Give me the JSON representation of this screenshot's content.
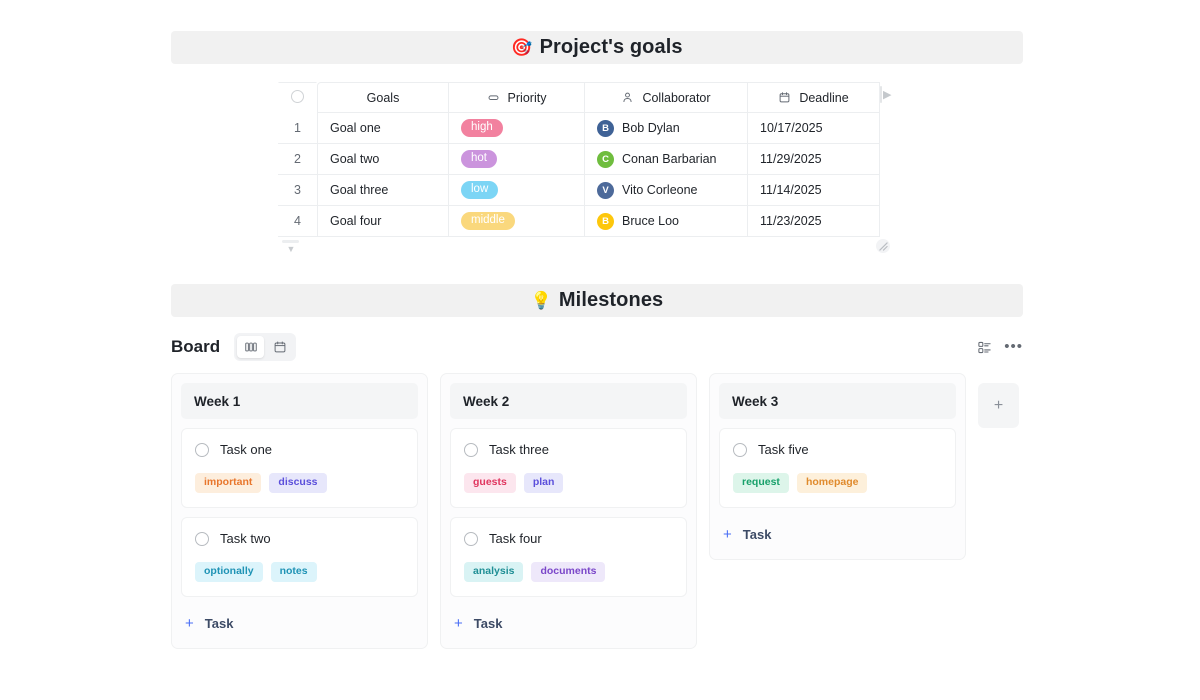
{
  "sections": {
    "goals_banner": {
      "emoji": "🎯",
      "title": "Project's goals",
      "icon": "target-icon"
    },
    "milestones_banner": {
      "emoji": "💡",
      "title": "Milestones",
      "icon": "lightbulb-icon"
    }
  },
  "goals_table": {
    "columns": [
      {
        "label": "Goals",
        "icon": null
      },
      {
        "label": "Priority",
        "icon": "capsule-icon"
      },
      {
        "label": "Collaborator",
        "icon": "person-icon"
      },
      {
        "label": "Deadline",
        "icon": "calendar-icon"
      }
    ],
    "rows": [
      {
        "index": "1",
        "goal": "Goal one",
        "priority": "high",
        "priority_color": "#f2819f",
        "collaborator": "Bob Dylan",
        "initial": "B",
        "avatar_color": "#3f6296",
        "deadline": "10/17/2025"
      },
      {
        "index": "2",
        "goal": "Goal two",
        "priority": "hot",
        "priority_color": "#cb94dd",
        "collaborator": "Conan Barbarian",
        "initial": "C",
        "avatar_color": "#6fbd3e",
        "deadline": "11/29/2025"
      },
      {
        "index": "3",
        "goal": "Goal three",
        "priority": "low",
        "priority_color": "#7cd5f5",
        "collaborator": "Vito Corleone",
        "initial": "V",
        "avatar_color": "#4d6a9a",
        "deadline": "11/14/2025"
      },
      {
        "index": "4",
        "goal": "Goal four",
        "priority": "middle",
        "priority_color": "#fad87d",
        "collaborator": "Bruce Loo",
        "initial": "B",
        "avatar_color": "#fdc70c",
        "deadline": "11/23/2025"
      }
    ]
  },
  "board": {
    "title": "Board",
    "view_toggle": [
      {
        "icon": "board-columns-icon",
        "active": true
      },
      {
        "icon": "calendar-icon",
        "active": false
      }
    ],
    "actions": [
      {
        "icon": "list-view-icon"
      },
      {
        "icon": "more-options-icon",
        "glyph": "•••"
      }
    ],
    "add_column_label": "+",
    "columns": [
      {
        "title": "Week 1",
        "add_task_label": "Task",
        "tasks": [
          {
            "title": "Task one",
            "chips": [
              {
                "label": "important",
                "bg": "#fdeedd",
                "fg": "#e8762c"
              },
              {
                "label": "discuss",
                "bg": "#e7e7fb",
                "fg": "#5b4fdb"
              }
            ]
          },
          {
            "title": "Task two",
            "chips": [
              {
                "label": "optionally",
                "bg": "#dcf4fb",
                "fg": "#1f93b5"
              },
              {
                "label": "notes",
                "bg": "#dcf4fb",
                "fg": "#1f93b5"
              }
            ]
          }
        ]
      },
      {
        "title": "Week 2",
        "add_task_label": "Task",
        "tasks": [
          {
            "title": "Task three",
            "chips": [
              {
                "label": "guests",
                "bg": "#fce6ee",
                "fg": "#e0365f"
              },
              {
                "label": "plan",
                "bg": "#e7e7fb",
                "fg": "#5b4fdb"
              }
            ]
          },
          {
            "title": "Task four",
            "chips": [
              {
                "label": "analysis",
                "bg": "#d9f3f4",
                "fg": "#1f8f95"
              },
              {
                "label": "documents",
                "bg": "#eee8fa",
                "fg": "#7a46c9"
              }
            ]
          }
        ]
      },
      {
        "title": "Week 3",
        "add_task_label": "Task",
        "tasks": [
          {
            "title": "Task five",
            "chips": [
              {
                "label": "request",
                "bg": "#ddf5ea",
                "fg": "#18a06a"
              },
              {
                "label": "homepage",
                "bg": "#fdf0db",
                "fg": "#e08a2c"
              }
            ]
          }
        ]
      }
    ]
  }
}
